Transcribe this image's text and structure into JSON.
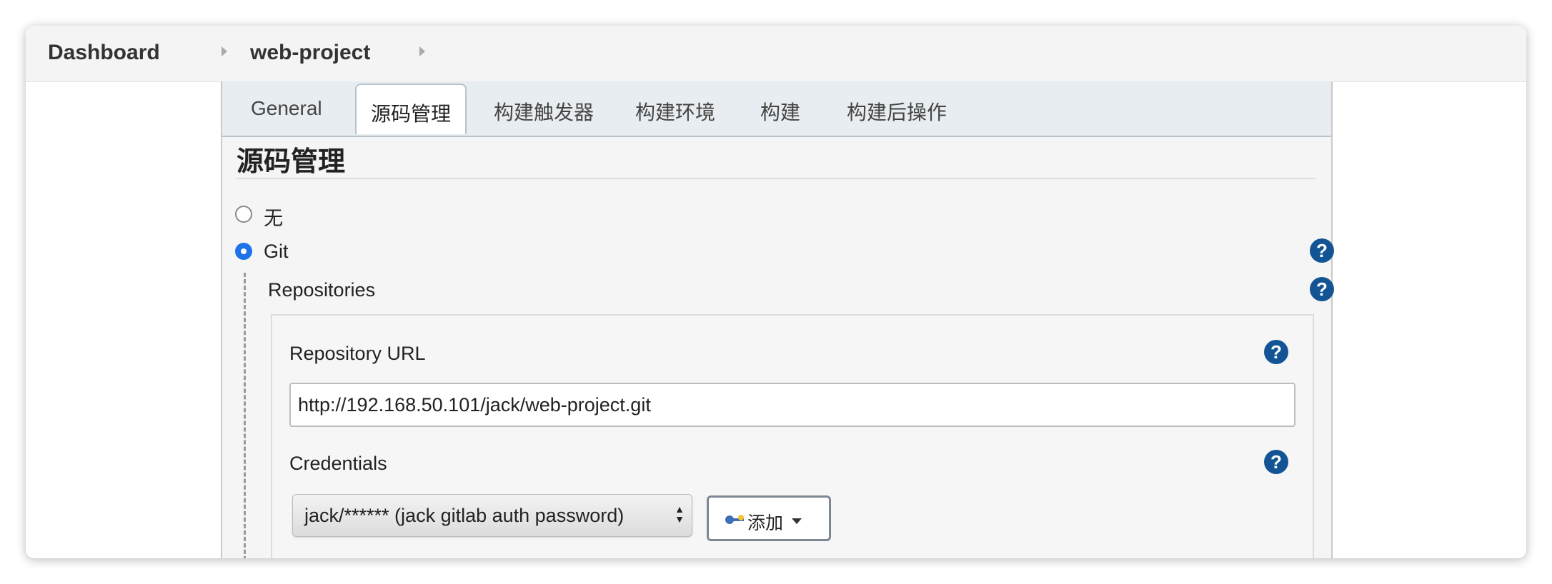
{
  "breadcrumb": {
    "items": [
      "Dashboard",
      "web-project"
    ]
  },
  "tabs": [
    "General",
    "源码管理",
    "构建触发器",
    "构建环境",
    "构建",
    "构建后操作"
  ],
  "active_tab": "源码管理",
  "section": {
    "title": "源码管理",
    "scm_options": [
      {
        "label": "无",
        "selected": false
      },
      {
        "label": "Git",
        "selected": true
      }
    ]
  },
  "git": {
    "repositories_label": "Repositories",
    "repository_url_label": "Repository URL",
    "repository_url_value": "http://192.168.50.101/jack/web-project.git",
    "credentials_label": "Credentials",
    "credentials_selected": "jack/****** (jack gitlab auth password)",
    "add_button_label": "添加"
  },
  "icons": {
    "help": "help-icon",
    "breadcrumb_separator": "chevron-right-icon",
    "key": "key-icon",
    "dropdown": "caret-down-icon"
  },
  "colors": {
    "help_icon": "#135594",
    "radio_checked": "#1e73e8",
    "tabbar_bg": "#e8edf1"
  }
}
